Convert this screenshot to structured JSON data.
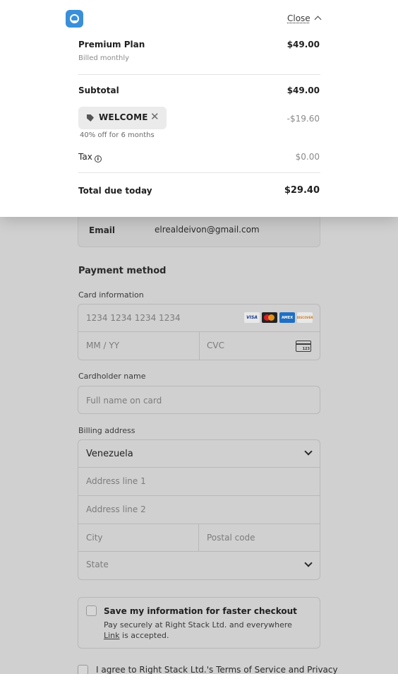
{
  "header": {
    "close_label": "Close"
  },
  "summary": {
    "plan_name": "Premium Plan",
    "plan_billing": "Billed monthly",
    "plan_price": "$49.00",
    "subtotal_label": "Subtotal",
    "subtotal_value": "$49.00",
    "promo_code": "WELCOME",
    "promo_discount": "-$19.60",
    "promo_note": "40% off for 6 months",
    "tax_label": "Tax",
    "tax_value": "$0.00",
    "total_label": "Total due today",
    "total_value": "$29.40"
  },
  "contact": {
    "email_label": "Email",
    "email_value": "elrealdeivon@gmail.com"
  },
  "payment": {
    "section_title": "Payment method",
    "card_info_label": "Card information",
    "card_number_placeholder": "1234 1234 1234 1234",
    "expiry_placeholder": "MM / YY",
    "cvc_placeholder": "CVC",
    "cvc_icon_text": "123",
    "brands": [
      "VISA",
      "",
      "AMEX",
      "DISCOVER"
    ],
    "cardholder_label": "Cardholder name",
    "cardholder_placeholder": "Full name on card"
  },
  "billing": {
    "label": "Billing address",
    "country": "Venezuela",
    "address1_placeholder": "Address line 1",
    "address2_placeholder": "Address line 2",
    "city_placeholder": "City",
    "postal_placeholder": "Postal code",
    "state_placeholder": "State"
  },
  "save": {
    "title": "Save my information for faster checkout",
    "desc_before": "Pay securely at Right Stack Ltd. and everywhere ",
    "desc_link": "Link",
    "desc_after": " is accepted."
  },
  "terms": {
    "text": "I agree to Right Stack Ltd.'s Terms of Service and Privacy"
  }
}
